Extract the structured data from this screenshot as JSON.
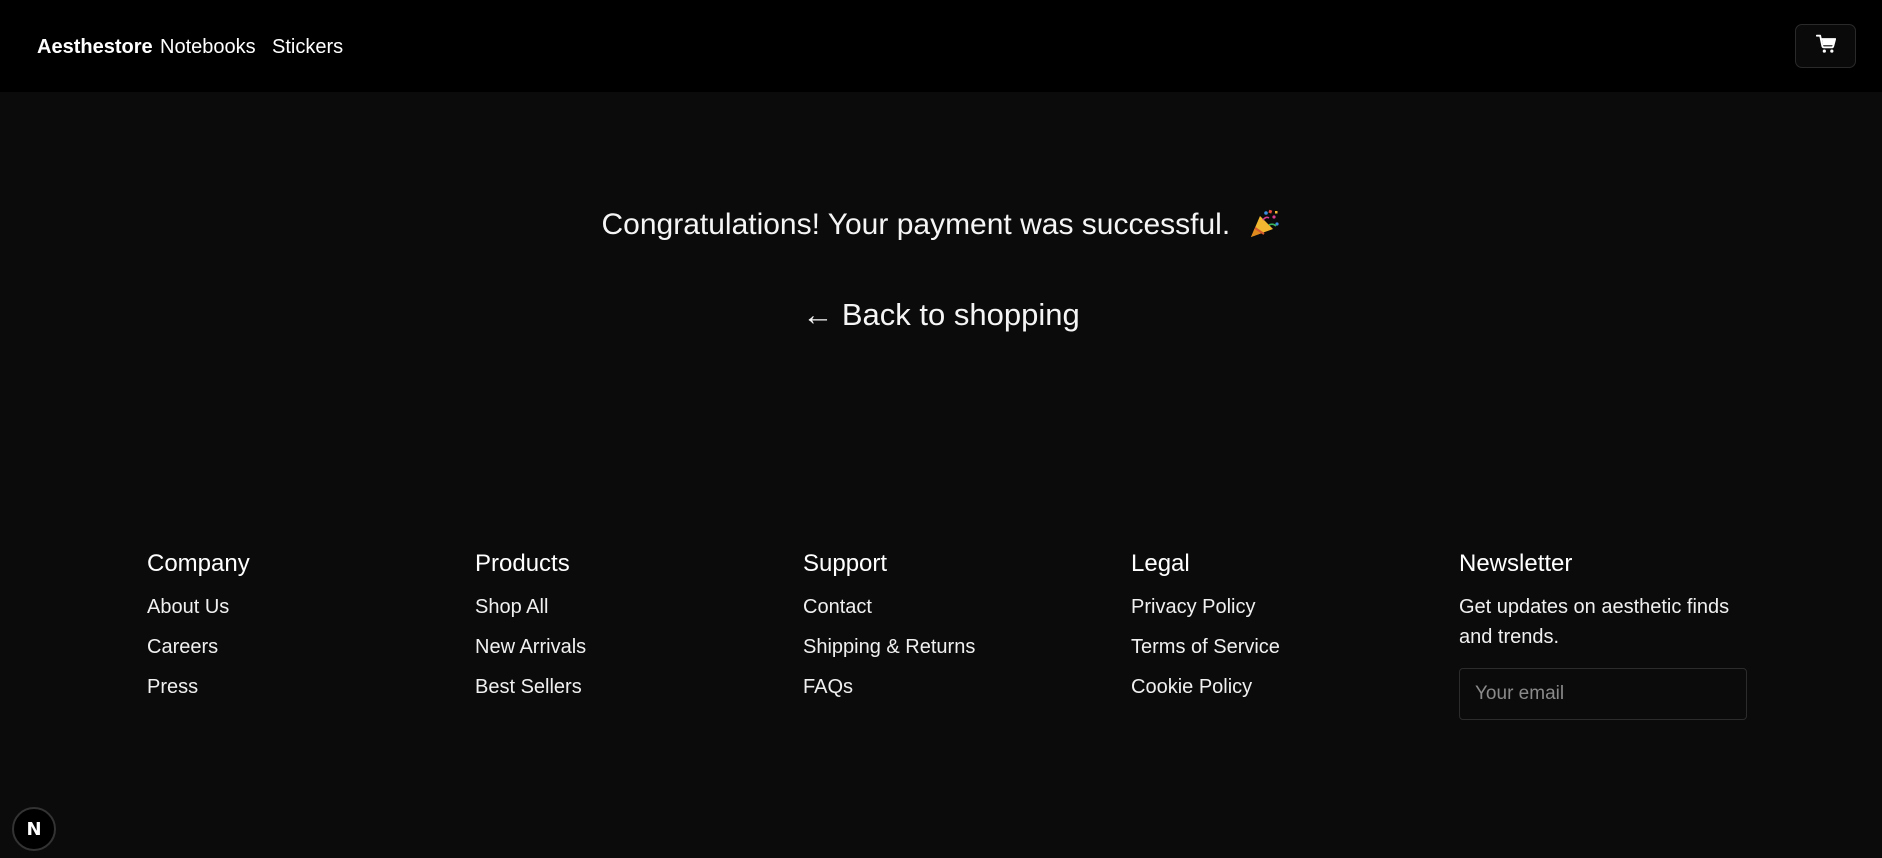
{
  "header": {
    "brand": "Aesthestore",
    "nav": [
      {
        "label": "Notebooks"
      },
      {
        "label": "Stickers"
      }
    ],
    "cart_icon": "shopping-cart-icon"
  },
  "main": {
    "success_message": "Congratulations! Your payment was successful.",
    "success_emoji_icon": "party-popper-icon",
    "back_link": "← Back to shopping"
  },
  "footer": {
    "columns": [
      {
        "heading": "Company",
        "links": [
          "About Us",
          "Careers",
          "Press"
        ]
      },
      {
        "heading": "Products",
        "links": [
          "Shop All",
          "New Arrivals",
          "Best Sellers"
        ]
      },
      {
        "heading": "Support",
        "links": [
          "Contact",
          "Shipping & Returns",
          "FAQs"
        ]
      },
      {
        "heading": "Legal",
        "links": [
          "Privacy Policy",
          "Terms of Service",
          "Cookie Policy"
        ]
      }
    ],
    "newsletter": {
      "heading": "Newsletter",
      "text": "Get updates on aesthetic finds and trends.",
      "placeholder": "Your email"
    }
  },
  "dev_badge": {
    "letter": "N"
  },
  "colors": {
    "header_bg": "#000000",
    "page_bg": "#0b0b0b",
    "text": "#f5f5f5"
  }
}
